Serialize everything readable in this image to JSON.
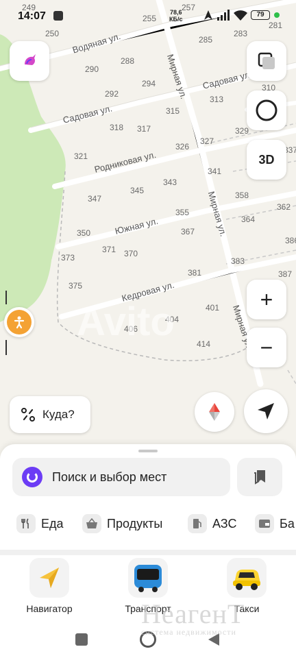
{
  "status_bar": {
    "time": "14:07",
    "net_speed_value": "78,6",
    "net_speed_unit": "КБ/с",
    "battery": "79"
  },
  "map": {
    "streets": [
      {
        "id": "vodyanaya",
        "text": "Водяная ул."
      },
      {
        "id": "mirnaya1",
        "text": "Мирная ул."
      },
      {
        "id": "sadovaya1",
        "text": "Садовая ул."
      },
      {
        "id": "sadovaya2",
        "text": "Садовая ул."
      },
      {
        "id": "rodnikovaya",
        "text": "Родниковая ул."
      },
      {
        "id": "mirnaya2",
        "text": "Мирная ул."
      },
      {
        "id": "yuzhnaya",
        "text": "Южная ул."
      },
      {
        "id": "kedrovaya",
        "text": "Кедровая ул."
      },
      {
        "id": "mirnaya3",
        "text": "Мирная ул."
      }
    ],
    "house_numbers": [
      "249",
      "257",
      "281",
      "255",
      "250",
      "285",
      "283",
      "288",
      "290",
      "294",
      "292",
      "310",
      "313",
      "315",
      "318",
      "317",
      "329",
      "321",
      "326",
      "327",
      "337",
      "341",
      "343",
      "345",
      "347",
      "358",
      "362",
      "355",
      "364",
      "350",
      "367",
      "371",
      "370",
      "373",
      "386",
      "383",
      "375",
      "381",
      "387",
      "401",
      "404",
      "406",
      "414"
    ],
    "watermark": "Avito"
  },
  "controls": {
    "layers_icon": "layers-icon",
    "alice_icon": "alice-icon",
    "three_d_label": "3D",
    "zoom_in_label": "+",
    "zoom_out_label": "−",
    "where_label": "Куда?"
  },
  "sheet": {
    "search_placeholder": "Поиск и выбор мест",
    "categories": [
      {
        "label": "Еда",
        "icon": "food-icon"
      },
      {
        "label": "Продукты",
        "icon": "basket-icon"
      },
      {
        "label": "АЗС",
        "icon": "fuel-icon"
      },
      {
        "label": "Ба",
        "icon": "bank-icon"
      }
    ],
    "apps": [
      {
        "label": "Навигатор",
        "icon": "navigator-icon"
      },
      {
        "label": "Транспорт",
        "icon": "bus-icon"
      },
      {
        "label": "Такси",
        "icon": "taxi-icon"
      }
    ]
  },
  "watermark_bottom": {
    "brand": "НеагенТ",
    "tagline": "система недвижимости"
  },
  "colors": {
    "map_bg": "#f4f2ec",
    "park": "#cde9b7",
    "road": "#ffffff",
    "alice": "#6c3cf5",
    "compass_red": "#e8453c",
    "taxi_yellow": "#fcd531",
    "bus_blue": "#2c8bd8",
    "pedestrian": "#f4a234"
  }
}
